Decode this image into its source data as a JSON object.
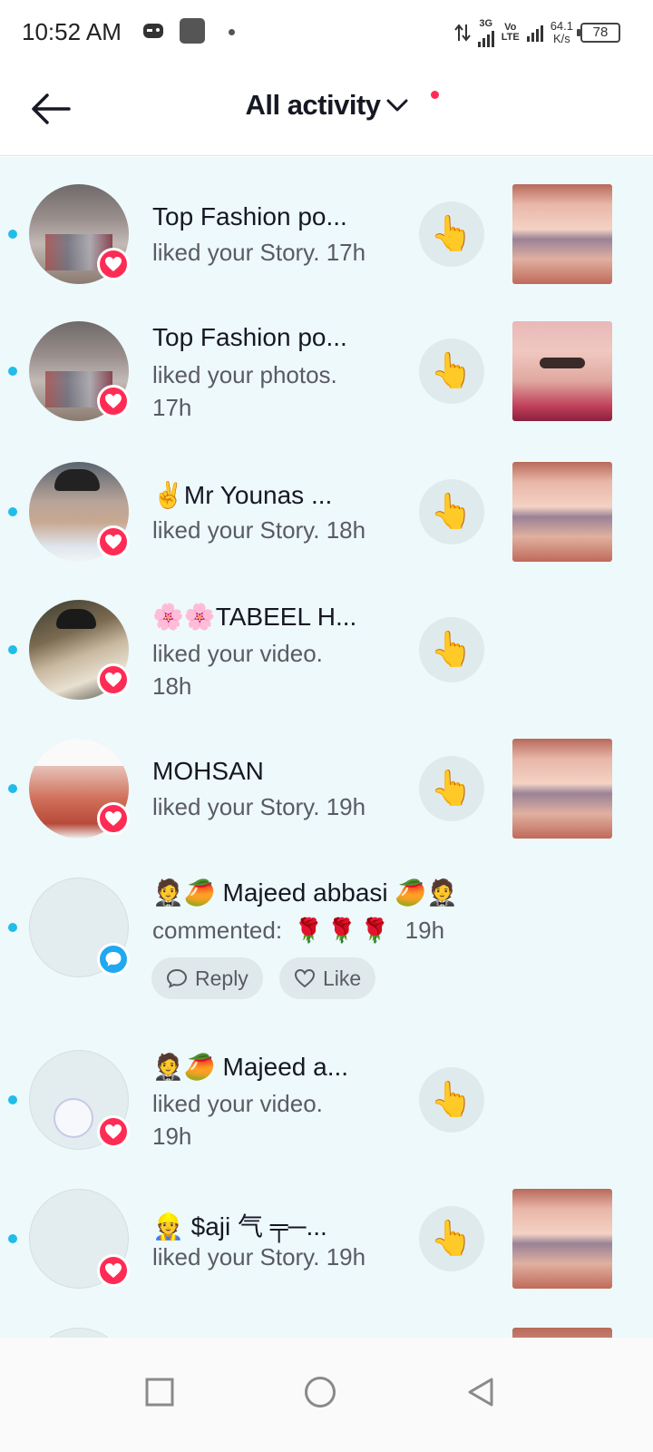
{
  "status_bar": {
    "time": "10:52 AM",
    "net1": "3G",
    "net2": "Vo\nLTE",
    "speed_value": "64.1",
    "speed_unit": "K/s",
    "battery": "78"
  },
  "header": {
    "title": "All activity",
    "back_icon": "arrow-left-icon",
    "dropdown_icon": "chevron-down-icon"
  },
  "colors": {
    "accent": "#fe2c55",
    "unread": "#20bde8",
    "list_bg": "#eef9fb"
  },
  "activities": [
    {
      "name": "Top Fashion po...",
      "text": "liked your Story. 17h",
      "badge": "heart-icon",
      "action": "wave-icon"
    },
    {
      "name": "Top Fashion po...",
      "text": "liked your photos.",
      "time": "17h",
      "badge": "heart-icon",
      "action": "wave-icon"
    },
    {
      "name": "✌️Mr Younas ...",
      "text": "liked your Story. 18h",
      "badge": "heart-icon",
      "action": "wave-icon"
    },
    {
      "name": "🌸🌸TABEEL H...",
      "text": "liked your video.",
      "time": "18h",
      "badge": "heart-icon",
      "action": "wave-icon"
    },
    {
      "name": "MOHSAN",
      "text": "liked your Story. 19h",
      "badge": "heart-icon",
      "action": "wave-icon"
    },
    {
      "name": "🤵🥭 Majeed abbasi 🥭🤵",
      "text_prefix": "commented:",
      "text_emoji": "🌹🌹🌹",
      "time": "19h",
      "badge": "comment-icon",
      "reply_label": "Reply",
      "like_label": "Like"
    },
    {
      "name": "🤵🥭 Majeed a...",
      "text": "liked your video.",
      "time": "19h",
      "badge": "heart-icon",
      "action": "wave-icon"
    },
    {
      "name": "👷 $aji 气 ╤─...",
      "text": "liked your Story. 19h",
      "badge": "heart-icon",
      "action": "wave-icon"
    }
  ],
  "nav": {
    "recent": "square-icon",
    "home": "circle-icon",
    "back": "triangle-back-icon"
  }
}
